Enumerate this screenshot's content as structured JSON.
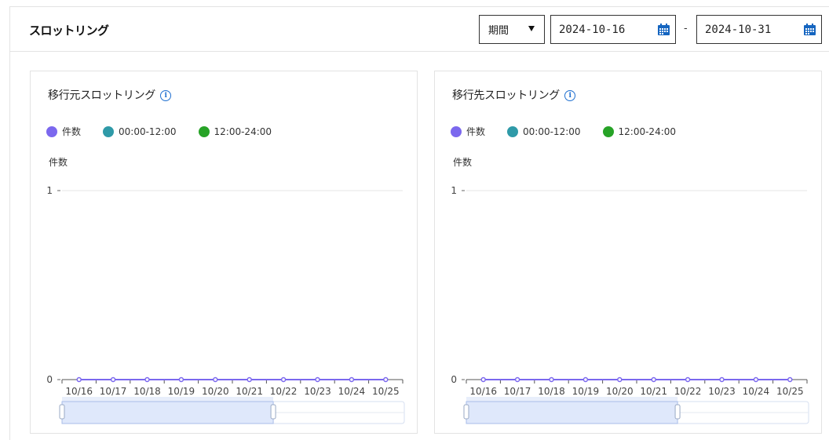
{
  "header": {
    "title": "スロットリング",
    "period_label": "期間",
    "date_from": "2024-10-16",
    "date_to": "2024-10-31",
    "date_separator": "-"
  },
  "colors": {
    "series_count": "#7b68ee",
    "series_am": "#2f9aa8",
    "series_pm": "#27a327",
    "calendar_icon": "#1565c0",
    "zoom_fill": "#dfe8fb"
  },
  "panels": [
    {
      "title": "移行元スロットリング",
      "legend": [
        "件数",
        "00:00-12:00",
        "12:00-24:00"
      ],
      "y_title": "件数"
    },
    {
      "title": "移行先スロットリング",
      "legend": [
        "件数",
        "00:00-12:00",
        "12:00-24:00"
      ],
      "y_title": "件数"
    }
  ],
  "chart_data": [
    {
      "type": "line",
      "title": "移行元スロットリング",
      "x": [
        "10/16",
        "10/17",
        "10/18",
        "10/19",
        "10/20",
        "10/21",
        "10/22",
        "10/23",
        "10/24",
        "10/25"
      ],
      "series": [
        {
          "name": "件数",
          "values": [
            0,
            0,
            0,
            0,
            0,
            0,
            0,
            0,
            0,
            0
          ]
        }
      ],
      "ylabel": "件数",
      "ylim": [
        0,
        1
      ],
      "yticks": [
        0,
        1
      ],
      "grid": true,
      "legend": "top-left",
      "zoom_range": [
        0,
        0.62
      ]
    },
    {
      "type": "line",
      "title": "移行先スロットリング",
      "x": [
        "10/16",
        "10/17",
        "10/18",
        "10/19",
        "10/20",
        "10/21",
        "10/22",
        "10/23",
        "10/24",
        "10/25"
      ],
      "series": [
        {
          "name": "件数",
          "values": [
            0,
            0,
            0,
            0,
            0,
            0,
            0,
            0,
            0,
            0
          ]
        }
      ],
      "ylabel": "件数",
      "ylim": [
        0,
        1
      ],
      "yticks": [
        0,
        1
      ],
      "grid": true,
      "legend": "top-left",
      "zoom_range": [
        0,
        0.62
      ]
    }
  ]
}
